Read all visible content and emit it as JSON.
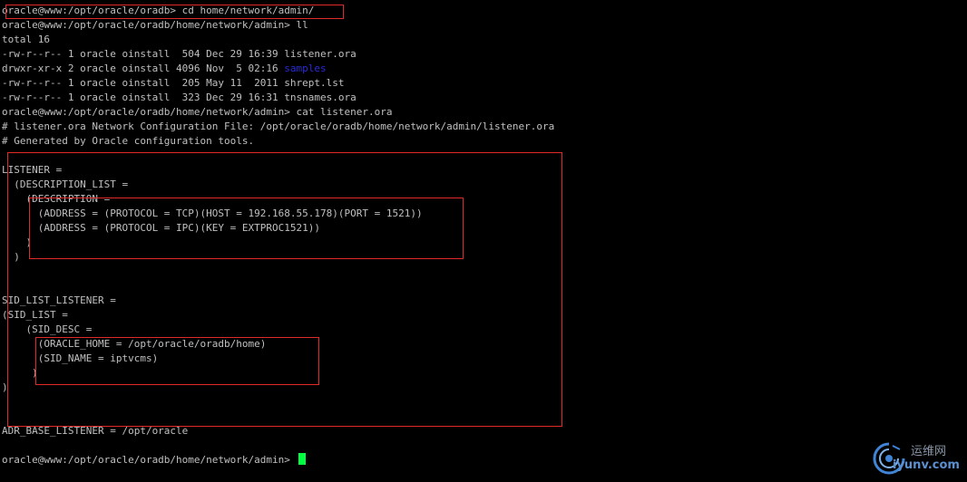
{
  "terminal": {
    "prompt": "oracle@www:/opt/oracle/oradb>",
    "lines": [
      "oracle@www:/opt/oracle/oradb> cd home/network/admin/",
      "oracle@www:/opt/oracle/oradb/home/network/admin> ll",
      "total 16",
      "-rw-r--r-- 1 oracle oinstall  504 Dec 29 16:39 listener.ora",
      "drwxr-xr-x 2 oracle oinstall 4096 Nov  5 02:16 ",
      "-rw-r--r-- 1 oracle oinstall  205 May 11  2011 shrept.lst",
      "-rw-r--r-- 1 oracle oinstall  323 Dec 29 16:31 tnsnames.ora",
      "oracle@www:/opt/oracle/oradb/home/network/admin> cat listener.ora",
      "# listener.ora Network Configuration File: /opt/oracle/oradb/home/network/admin/listener.ora",
      "# Generated by Oracle configuration tools.",
      "",
      "LISTENER =",
      "  (DESCRIPTION_LIST =",
      "    (DESCRIPTION =",
      "      (ADDRESS = (PROTOCOL = TCP)(HOST = 192.168.55.178)(PORT = 1521))",
      "      (ADDRESS = (PROTOCOL = IPC)(KEY = EXTPROC1521))",
      "    )",
      "  )",
      "",
      "",
      "SID_LIST_LISTENER =",
      "(SID_LIST =",
      "    (SID_DESC =",
      "      (ORACLE_HOME = /opt/oracle/oradb/home)",
      "      (SID_NAME = iptvcms)",
      "     )",
      ")",
      "",
      "",
      "ADR_BASE_LISTENER = /opt/oracle",
      "",
      "oracle@www:/opt/oracle/oradb/home/network/admin> "
    ],
    "dir_entry": "samples"
  },
  "watermark": {
    "cn_text": "运维网",
    "en_text": "iyunv.com"
  },
  "colors": {
    "background": "#000000",
    "text": "#c0c0c0",
    "directory": "#2a2ad8",
    "cursor": "#00ff40",
    "highlight_box": "#e02a2a"
  }
}
